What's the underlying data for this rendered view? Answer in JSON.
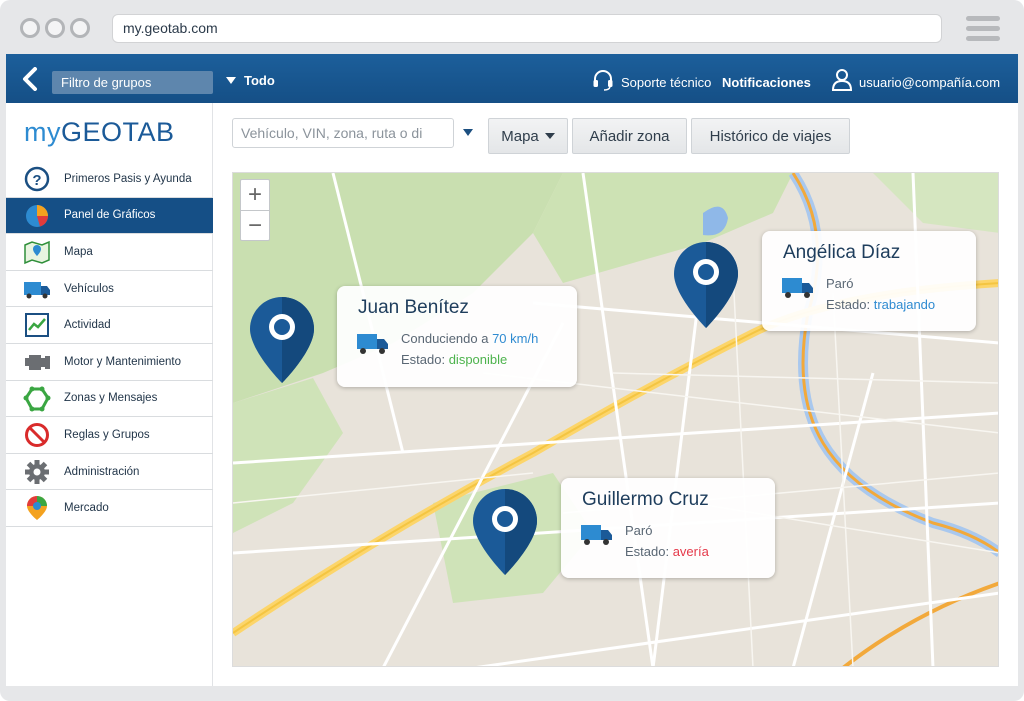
{
  "browser": {
    "url": "my.geotab.com"
  },
  "topbar": {
    "group_filter_label": "Filtro de grupos",
    "group_value": "Todo",
    "support_label": "Soporte técnico",
    "notifications_label": "Notificaciones",
    "user_label": "usuario@compañía.com"
  },
  "logo": {
    "prefix": "my",
    "name": "GEOTAB"
  },
  "sidebar": {
    "items": [
      {
        "label": "Primeros Pasis y Ayunda",
        "icon": "help-icon"
      },
      {
        "label": "Panel de Gráficos",
        "icon": "pie-chart-icon",
        "active": true
      },
      {
        "label": "Mapa",
        "icon": "map-icon"
      },
      {
        "label": "Vehículos",
        "icon": "truck-icon"
      },
      {
        "label": "Actividad",
        "icon": "activity-icon"
      },
      {
        "label": "Motor y Mantenimiento",
        "icon": "engine-icon"
      },
      {
        "label": "Zonas y Mensajes",
        "icon": "zone-icon"
      },
      {
        "label": "Reglas y Grupos",
        "icon": "rules-icon"
      },
      {
        "label": "Administración",
        "icon": "gear-icon"
      },
      {
        "label": "Mercado",
        "icon": "marketplace-icon"
      }
    ]
  },
  "toolbar": {
    "search_placeholder": "Vehículo, VIN, zona, ruta o di",
    "map_button": "Mapa",
    "add_zone_button": "Añadir zona",
    "history_button": "Histórico de viajes"
  },
  "map": {
    "zoom_in": "+",
    "zoom_out": "−",
    "drivers": [
      {
        "name": "Juan Benítez",
        "activity_prefix": "Conduciendo a ",
        "speed": "70 km/h",
        "status_prefix": "Estado: ",
        "status": "disponible",
        "status_color": "#4db34d"
      },
      {
        "name": "Angélica Díaz",
        "activity_prefix": "Paró",
        "speed": "",
        "status_prefix": "Estado: ",
        "status": "trabajando",
        "status_color": "#2f8bd1"
      },
      {
        "name": "Guillermo Cruz",
        "activity_prefix": "Paró",
        "speed": "",
        "status_prefix": "Estado: ",
        "status": "avería",
        "status_color": "#e5394a"
      }
    ]
  },
  "colors": {
    "brand_dark": "#154f86",
    "brand_light": "#2d8bd1",
    "pin": "#1b5a98"
  }
}
